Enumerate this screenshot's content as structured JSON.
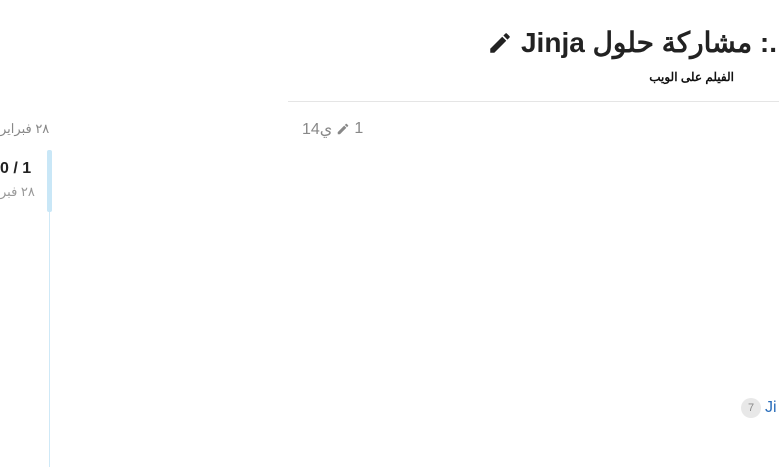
{
  "header": {
    "title": ".: مشاركة حلول Jinja",
    "subtitle": "الفيلم على الويب"
  },
  "meta": {
    "count": "1",
    "age": "14ي"
  },
  "sidebar": {
    "date_top": "٢٨ فبراير",
    "counter": "0 / 1",
    "counter_date": "٢٨ فبر"
  },
  "tags": [
    {
      "count": "7",
      "label": "Ji"
    }
  ],
  "icons": {
    "title_edit": "pencil-icon",
    "meta_edit": "pencil-icon"
  },
  "colors": {
    "link": "#2a6ebb",
    "timeline": "#c9e7f7",
    "muted": "#888888"
  }
}
